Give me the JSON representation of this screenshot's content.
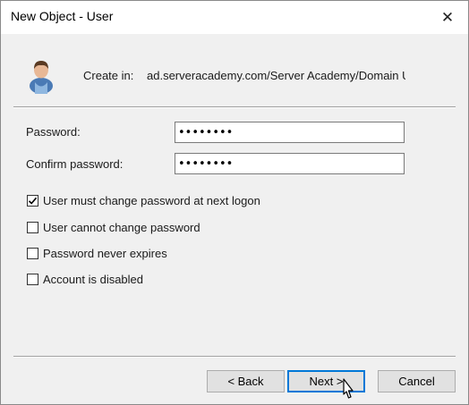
{
  "window": {
    "title": "New Object - User",
    "close_glyph": "✕"
  },
  "header": {
    "create_in_label": "Create in:",
    "create_in_path": "ad.serveracademy.com/Server Academy/Domain U"
  },
  "fields": {
    "password_label": "Password:",
    "password_value": "12345678",
    "confirm_label": "Confirm password:",
    "confirm_value": "12345678"
  },
  "options": [
    {
      "label": "User must change password at next logon",
      "checked": true
    },
    {
      "label": "User cannot change password",
      "checked": false
    },
    {
      "label": "Password never expires",
      "checked": false
    },
    {
      "label": "Account is disabled",
      "checked": false
    }
  ],
  "buttons": {
    "back": "< Back",
    "next": "Next >",
    "cancel": "Cancel"
  },
  "colors": {
    "accent": "#0078d7",
    "window_bg": "#f0f0f0"
  },
  "icons": {
    "user": "user-icon",
    "close": "close-icon",
    "cursor": "mouse-cursor-icon"
  }
}
